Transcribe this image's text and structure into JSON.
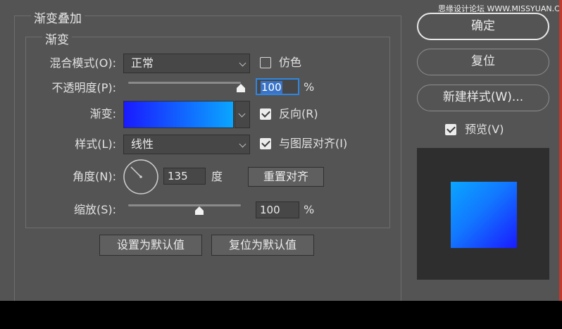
{
  "watermark": "思缘设计论坛 WWW.MISSYUAN.COM",
  "groups": {
    "outer_title": "渐变叠加",
    "inner_title": "渐变"
  },
  "blend_mode": {
    "label": "混合模式(O):",
    "value": "正常"
  },
  "dither": {
    "label": "仿色",
    "checked": false
  },
  "opacity": {
    "label": "不透明度(P):",
    "value": "100",
    "unit": "%",
    "slider_fraction": 1.0
  },
  "gradient": {
    "label": "渐变:",
    "colors": [
      "#1a1aff",
      "#0aa6ff"
    ]
  },
  "reverse": {
    "label": "反向(R)",
    "checked": true
  },
  "style": {
    "label": "样式(L):",
    "value": "线性"
  },
  "align_layer": {
    "label": "与图层对齐(I)",
    "checked": true
  },
  "angle": {
    "label": "角度(N):",
    "value": "135",
    "unit": "度"
  },
  "reset_alignment": "重置对齐",
  "scale": {
    "label": "缩放(S):",
    "value": "100",
    "unit": "%",
    "slider_fraction": 0.63
  },
  "bottom_buttons": {
    "set_default": "设置为默认值",
    "reset_default": "复位为默认值"
  },
  "side": {
    "ok": "确定",
    "reset": "复位",
    "new_style": "新建样式(W)...",
    "preview_label": "预览(V)",
    "preview_checked": true
  }
}
